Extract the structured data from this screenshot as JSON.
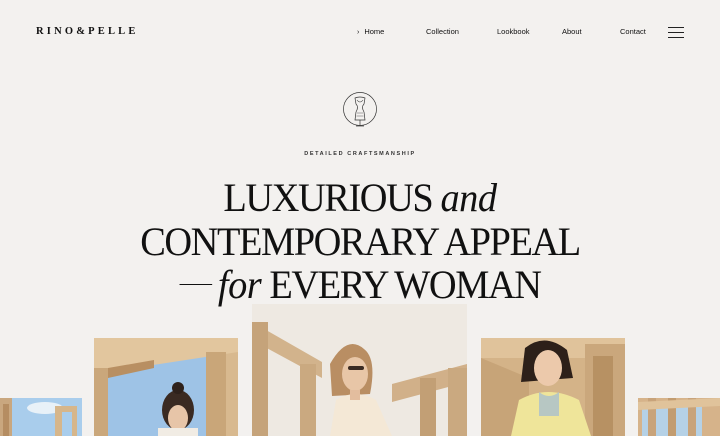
{
  "brand": {
    "logo_text": "RINO&PELLE"
  },
  "nav": {
    "items": [
      {
        "label": "Home",
        "active": true
      },
      {
        "label": "Collection"
      },
      {
        "label": "Lookbook"
      },
      {
        "label": "About"
      },
      {
        "label": "Contact"
      }
    ],
    "active_marker": "›",
    "menu_icon": "hamburger-icon"
  },
  "hero": {
    "emblem_icon": "dress-form-icon",
    "eyebrow": "DETAILED CRAFTSMANSHIP",
    "line1_a": "LUXURIOUS ",
    "line1_b": "and",
    "line2": "CONTEMPORARY APPEAL",
    "line3_a": "for",
    "line3_b": " EVERY WOMAN"
  },
  "colors": {
    "background": "#f3f1ef",
    "text": "#111111",
    "photo_sand": "#d9b88f",
    "photo_sky": "#9ec3e6"
  }
}
